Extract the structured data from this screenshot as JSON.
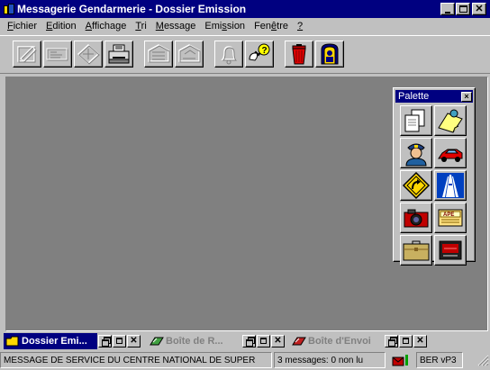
{
  "window": {
    "title": "Messagerie Gendarmerie - Dossier Emission"
  },
  "menu": [
    {
      "label": "Fichier",
      "key": "F",
      "rest": "ichier"
    },
    {
      "label": "Edition",
      "key": "E",
      "rest": "dition"
    },
    {
      "label": "Affichage",
      "key": "A",
      "rest": "ffichage"
    },
    {
      "label": "Tri",
      "key": "T",
      "rest": "ri"
    },
    {
      "label": "Message",
      "key": "M",
      "rest": "essage"
    },
    {
      "label": "Emission",
      "pre": "Emi",
      "key": "s",
      "rest": "sion"
    },
    {
      "label": "Fenêtre",
      "pre": "Fen",
      "key": "ê",
      "rest": "tre"
    },
    {
      "label": "?",
      "key": "?",
      "rest": ""
    }
  ],
  "toolbar": {
    "buttons": [
      {
        "name": "compose-icon",
        "enabled": false
      },
      {
        "name": "form-icon",
        "enabled": false
      },
      {
        "name": "forward-icon",
        "enabled": false
      },
      {
        "name": "print-icon",
        "enabled": true
      },
      {
        "name": "previous-message-icon",
        "enabled": false
      },
      {
        "name": "next-message-icon",
        "enabled": false
      },
      {
        "name": "bell-icon",
        "enabled": false
      },
      {
        "name": "help-pointer-icon",
        "enabled": true
      },
      {
        "name": "trash-icon",
        "enabled": true
      },
      {
        "name": "exit-door-icon",
        "enabled": true
      }
    ]
  },
  "palette": {
    "title": "Palette",
    "close": "×",
    "tools": [
      {
        "name": "new-document-icon"
      },
      {
        "name": "sticky-note-icon"
      },
      {
        "name": "gendarme-icon"
      },
      {
        "name": "red-car-icon"
      },
      {
        "name": "road-sign-icon"
      },
      {
        "name": "highway-icon"
      },
      {
        "name": "camera-icon"
      },
      {
        "name": "ape-card-icon"
      },
      {
        "name": "briefcase-icon"
      },
      {
        "name": "terminal-icon"
      }
    ]
  },
  "taskbar": {
    "items": [
      {
        "label": "Dossier Emi...",
        "state": "active",
        "icon": "folder-icon",
        "icon_color": "#ffd700"
      },
      {
        "label": "Boîte de R...",
        "state": "inactive",
        "icon": "inbox-icon",
        "icon_color": "#40a040"
      },
      {
        "label": "Boîte d'Envoi",
        "state": "inactive",
        "icon": "outbox-icon",
        "icon_color": "#c02020"
      }
    ]
  },
  "status": {
    "message": "MESSAGE DE SERVICE DU CENTRE NATIONAL DE SUPER",
    "count": "3 messages: 0 non lu",
    "network": "BER vP3"
  },
  "colors": {
    "title_bar": "#000080",
    "face": "#c0c0c0",
    "workspace": "#808080"
  }
}
